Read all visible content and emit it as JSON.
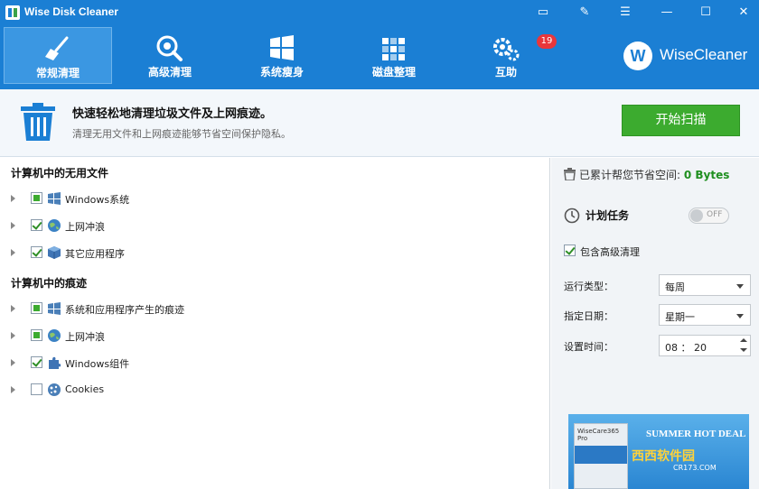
{
  "window": {
    "title": "Wise Disk Cleaner",
    "controls": [
      "▭",
      "✎",
      "☰",
      "—",
      "☐",
      "✕"
    ]
  },
  "toolbar": {
    "tabs": [
      {
        "label": "常规清理",
        "icon": "broom-icon",
        "active": true
      },
      {
        "label": "高级清理",
        "icon": "search-disk-icon",
        "active": false
      },
      {
        "label": "系统瘦身",
        "icon": "windows-icon",
        "active": false
      },
      {
        "label": "磁盘整理",
        "icon": "defrag-blocks-icon",
        "active": false
      },
      {
        "label": "互助",
        "icon": "gears-icon",
        "active": false,
        "badge": "19"
      }
    ],
    "brand_logo": "W",
    "brand": "WiseCleaner"
  },
  "info": {
    "icon": "trash-icon",
    "title": "快速轻松地清理垃圾文件及上网痕迹。",
    "subtitle": "清理无用文件和上网痕迹能够节省空间保护隐私。",
    "scan_button": "开始扫描"
  },
  "tree": {
    "groups": [
      {
        "title": "计算机中的无用文件",
        "items": [
          {
            "label": "Windows系统",
            "state": "partial",
            "icon": "windows-flag-icon"
          },
          {
            "label": "上网冲浪",
            "state": "checked",
            "icon": "globe-icon"
          },
          {
            "label": "其它应用程序",
            "state": "checked",
            "icon": "package-box-icon"
          }
        ]
      },
      {
        "title": "计算机中的痕迹",
        "items": [
          {
            "label": "系统和应用程序产生的痕迹",
            "state": "partial",
            "icon": "windows-flag-icon"
          },
          {
            "label": "上网冲浪",
            "state": "partial",
            "icon": "globe-icon"
          },
          {
            "label": "Windows组件",
            "state": "checked",
            "icon": "puzzle-icon"
          },
          {
            "label": "Cookies",
            "state": "unchecked",
            "icon": "cookie-icon"
          }
        ]
      }
    ]
  },
  "panel": {
    "saved_label": "已累计帮您节省空间:",
    "saved_value": "0 Bytes",
    "schedule_title": "计划任务",
    "toggle_text": "OFF",
    "include_advanced": "包含高级清理",
    "run_type_label": "运行类型：",
    "run_type_value": "每周",
    "date_label": "指定日期：",
    "date_value": "星期一",
    "time_label": "设置时间：",
    "time_value": "08 ： 20"
  },
  "ad": {
    "box_label": "WiseCare365 Pro",
    "headline": "SUMMER HOT DEAL",
    "watermark": "西西软件园",
    "watermark_url": "CR173.COM"
  },
  "colors": {
    "header": "#1b7fd4",
    "scan": "#3cab2f",
    "badge": "#e8363b",
    "saved_value": "#1f8f1f"
  }
}
